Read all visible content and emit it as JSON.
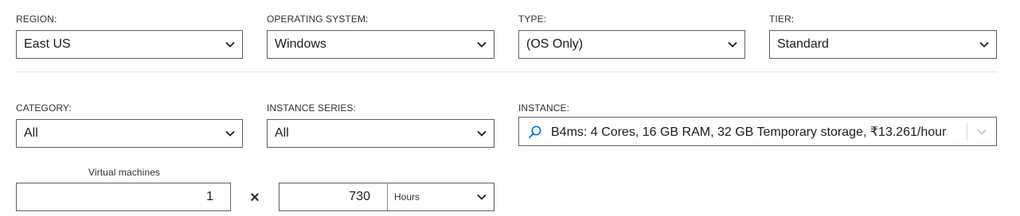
{
  "region": {
    "label": "REGION:",
    "value": "East US"
  },
  "os": {
    "label": "OPERATING SYSTEM:",
    "value": "Windows"
  },
  "type": {
    "label": "TYPE:",
    "value": "(OS Only)"
  },
  "tier": {
    "label": "TIER:",
    "value": "Standard"
  },
  "category": {
    "label": "CATEGORY:",
    "value": "All"
  },
  "series": {
    "label": "INSTANCE SERIES:",
    "value": "All"
  },
  "instance": {
    "label": "INSTANCE:",
    "value": "B4ms: 4 Cores, 16 GB RAM, 32 GB Temporary storage, ₹13.261/hour",
    "icon": "search-icon"
  },
  "vms": {
    "label": "Virtual machines",
    "value": "1"
  },
  "multiply": "×",
  "hours": {
    "value": "730",
    "unit": "Hours"
  },
  "colors": {
    "accent": "#0078d4",
    "border": "#5f5f5f"
  }
}
